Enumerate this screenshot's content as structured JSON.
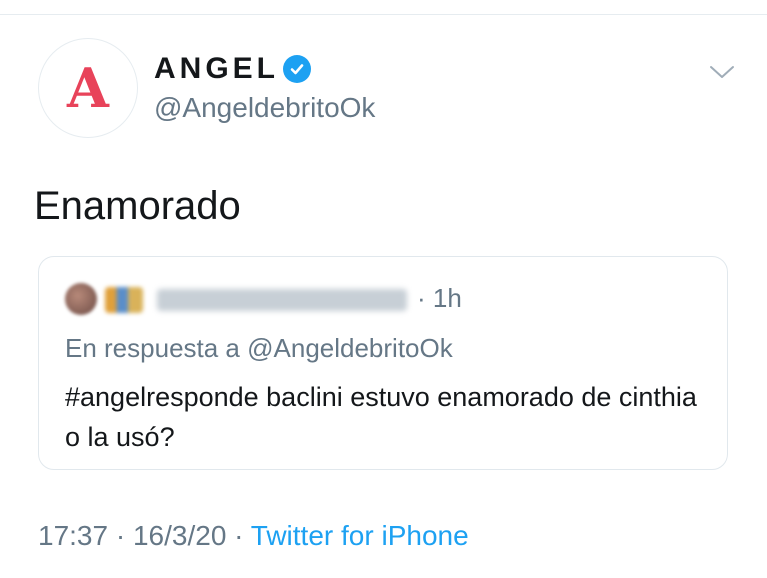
{
  "author": {
    "avatar_letter": "A",
    "name": "ANGEL",
    "handle": "@AngeldebritoOk",
    "verified": true
  },
  "tweet": {
    "text": "Enamorado"
  },
  "quoted": {
    "time": "· 1h",
    "reply_prefix": "En respuesta a",
    "reply_handle": "@AngeldebritoOk",
    "text": "#angelresponde baclini estuvo enamorado de cinthia o la usó?"
  },
  "meta": {
    "time": "17:37",
    "sep1": " · ",
    "date": "16/3/20",
    "sep2": " · ",
    "source": "Twitter for iPhone"
  },
  "colors": {
    "brand_red": "#e8435a",
    "link_blue": "#1da1f2",
    "muted": "#657786"
  },
  "icons": {
    "verified": "verified-badge-icon",
    "menu": "chevron-down-icon"
  }
}
